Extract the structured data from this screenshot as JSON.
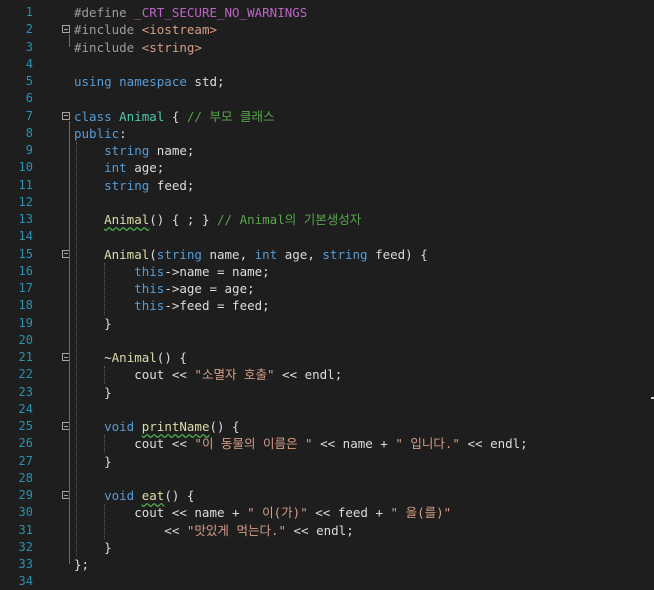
{
  "colors": {
    "background": "#1e1e1e",
    "line_number": "#2b91af",
    "default": "#dcdcdc",
    "keyword": "#569cd6",
    "preprocessor": "#9b9b9b",
    "string": "#d69d85",
    "comment": "#57a64a",
    "type": "#4ec9b0",
    "macro": "#bd63c5",
    "function": "#dcdcaa",
    "variable": "#9cdcfe"
  },
  "editor": {
    "lines": [
      {
        "n": "1",
        "tokens": [
          [
            "#define ",
            "preprocessor"
          ],
          [
            "_CRT_SECURE_NO_WARNINGS",
            "macro"
          ]
        ]
      },
      {
        "n": "2",
        "tokens": [
          [
            "#include ",
            "preprocessor"
          ],
          [
            "<iostream>",
            "string"
          ]
        ]
      },
      {
        "n": "3",
        "tokens": [
          [
            "#include ",
            "preprocessor"
          ],
          [
            "<string>",
            "string"
          ]
        ]
      },
      {
        "n": "4",
        "tokens": []
      },
      {
        "n": "5",
        "tokens": [
          [
            "using ",
            "keyword"
          ],
          [
            "namespace ",
            "keyword"
          ],
          [
            "std;",
            "default"
          ]
        ]
      },
      {
        "n": "6",
        "tokens": []
      },
      {
        "n": "7",
        "tokens": [
          [
            "class ",
            "keyword"
          ],
          [
            "Animal",
            "type"
          ],
          [
            " { ",
            "default"
          ],
          [
            "// 부모 클래스",
            "comment"
          ]
        ]
      },
      {
        "n": "8",
        "tokens": [
          [
            "public",
            "keyword"
          ],
          [
            ":",
            "default"
          ]
        ]
      },
      {
        "n": "9",
        "tokens": [
          [
            "    string ",
            "keyword"
          ],
          [
            "name;",
            "default"
          ]
        ]
      },
      {
        "n": "10",
        "tokens": [
          [
            "    int ",
            "keyword"
          ],
          [
            "age;",
            "default"
          ]
        ]
      },
      {
        "n": "11",
        "tokens": [
          [
            "    string ",
            "keyword"
          ],
          [
            "feed;",
            "default"
          ]
        ]
      },
      {
        "n": "12",
        "tokens": []
      },
      {
        "n": "13",
        "tokens": [
          [
            "    ",
            "default"
          ],
          [
            "Animal",
            "function_sq"
          ],
          [
            "() { ; } ",
            "default"
          ],
          [
            "// Animal의 기본생성자",
            "comment"
          ]
        ]
      },
      {
        "n": "14",
        "tokens": []
      },
      {
        "n": "15",
        "tokens": [
          [
            "    ",
            "default"
          ],
          [
            "Animal",
            "function"
          ],
          [
            "(",
            "default"
          ],
          [
            "string ",
            "keyword"
          ],
          [
            "name, ",
            "default"
          ],
          [
            "int ",
            "keyword"
          ],
          [
            "age, ",
            "default"
          ],
          [
            "string ",
            "keyword"
          ],
          [
            "feed) {",
            "default"
          ]
        ]
      },
      {
        "n": "16",
        "tokens": [
          [
            "        ",
            "default"
          ],
          [
            "this",
            "keyword"
          ],
          [
            "->name = name;",
            "default"
          ]
        ]
      },
      {
        "n": "17",
        "tokens": [
          [
            "        ",
            "default"
          ],
          [
            "this",
            "keyword"
          ],
          [
            "->age = age;",
            "default"
          ]
        ]
      },
      {
        "n": "18",
        "tokens": [
          [
            "        ",
            "default"
          ],
          [
            "this",
            "keyword"
          ],
          [
            "->feed = feed;",
            "default"
          ]
        ]
      },
      {
        "n": "19",
        "tokens": [
          [
            "    }",
            "default"
          ]
        ]
      },
      {
        "n": "20",
        "tokens": []
      },
      {
        "n": "21",
        "tokens": [
          [
            "    ~",
            "default"
          ],
          [
            "Animal",
            "function"
          ],
          [
            "() {",
            "default"
          ]
        ]
      },
      {
        "n": "22",
        "tokens": [
          [
            "        cout << ",
            "default"
          ],
          [
            "\"소멸자 호출\"",
            "string"
          ],
          [
            " << endl;",
            "default"
          ]
        ]
      },
      {
        "n": "23",
        "tokens": [
          [
            "    }",
            "default"
          ]
        ]
      },
      {
        "n": "24",
        "tokens": []
      },
      {
        "n": "25",
        "tokens": [
          [
            "    ",
            "default"
          ],
          [
            "void ",
            "keyword"
          ],
          [
            "printName",
            "function_sq"
          ],
          [
            "() {",
            "default"
          ]
        ]
      },
      {
        "n": "26",
        "tokens": [
          [
            "        cout << ",
            "default"
          ],
          [
            "\"이 동물의 이름은 \"",
            "string"
          ],
          [
            " << name + ",
            "default"
          ],
          [
            "\" 입니다.\"",
            "string"
          ],
          [
            " << endl;",
            "default"
          ]
        ]
      },
      {
        "n": "27",
        "tokens": [
          [
            "    }",
            "default"
          ]
        ]
      },
      {
        "n": "28",
        "tokens": []
      },
      {
        "n": "29",
        "tokens": [
          [
            "    ",
            "default"
          ],
          [
            "void ",
            "keyword"
          ],
          [
            "eat",
            "function_sq"
          ],
          [
            "() {",
            "default"
          ]
        ]
      },
      {
        "n": "30",
        "tokens": [
          [
            "        cout << name + ",
            "default"
          ],
          [
            "\" 이(가)\"",
            "string"
          ],
          [
            " << feed + ",
            "default"
          ],
          [
            "\" 을(를)\"",
            "string"
          ]
        ]
      },
      {
        "n": "31",
        "tokens": [
          [
            "            << ",
            "default"
          ],
          [
            "\"맛있게 먹는다.\"",
            "string"
          ],
          [
            " << endl;",
            "default"
          ]
        ]
      },
      {
        "n": "32",
        "tokens": [
          [
            "    }",
            "default"
          ]
        ]
      },
      {
        "n": "33",
        "tokens": [
          [
            "};",
            "default"
          ]
        ]
      },
      {
        "n": "34",
        "tokens": []
      }
    ]
  }
}
